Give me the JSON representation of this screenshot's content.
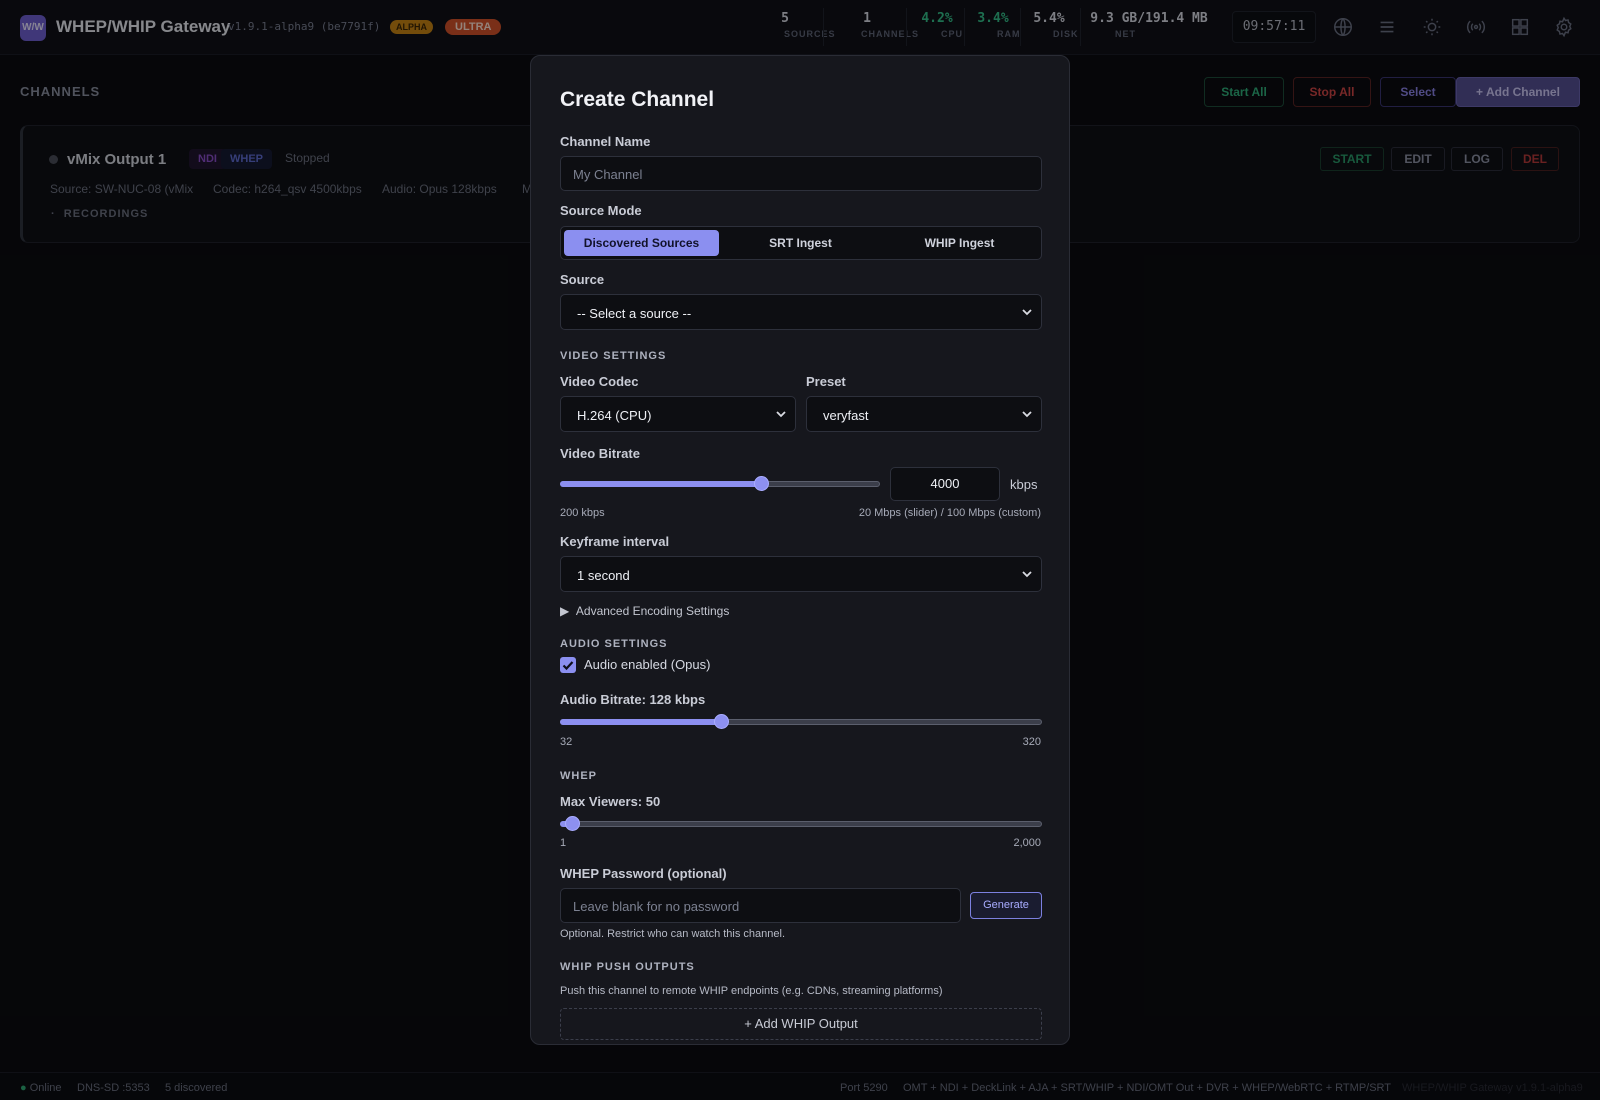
{
  "app": {
    "logo_text": "W/W",
    "title": "WHEP/WHIP Gateway",
    "version": "v1.9.1-alpha9 (be7791f)",
    "badge_alpha": "ALPHA",
    "badge_ultra": "ULTRA",
    "accent_color": "#8b8ff0"
  },
  "stats": [
    {
      "value": "5",
      "label": "SOURCES"
    },
    {
      "value": "1",
      "label": "CHANNELS"
    },
    {
      "value": "4.2%",
      "label": "CPU"
    },
    {
      "value": "3.4%",
      "label": "RAM"
    },
    {
      "value": "5.4%",
      "label": "DISK"
    },
    {
      "value": "9.3 GB/191.4 MB",
      "label": "NET"
    }
  ],
  "clock": "09:57:11",
  "toolbar_icons": [
    "globe-icon",
    "menu-icon",
    "sun-icon",
    "broadcast-icon",
    "grid-icon",
    "gear-icon"
  ],
  "page": {
    "section_title": "CHANNELS",
    "start_all": "Start All",
    "stop_all": "Stop All",
    "select": "Select",
    "add_channel": "+ Add Channel"
  },
  "channel": {
    "name": "vMix Output 1",
    "tags": [
      "NDI",
      "WHEP"
    ],
    "status": "Stopped",
    "source": "Source: SW-NUC-08 (vMix",
    "codec": "Codec: h264_qsv 4500kbps",
    "audio": "Audio: Opus 128kbps",
    "more": "M",
    "recordings": "RECORDINGS",
    "actions": [
      "START",
      "EDIT",
      "LOG",
      "DEL"
    ]
  },
  "modal": {
    "title": "Create Channel",
    "channel_name_label": "Channel Name",
    "channel_name_placeholder": "My Channel",
    "source_mode_label": "Source Mode",
    "source_modes": [
      "Discovered Sources",
      "SRT Ingest",
      "WHIP Ingest"
    ],
    "source_mode_active": "Discovered Sources",
    "source_label": "Source",
    "source_value": "-- Select a source --",
    "video_section": "VIDEO SETTINGS",
    "video_codec_label": "Video Codec",
    "video_codec_value": "H.264 (CPU)",
    "preset_label": "Preset",
    "preset_value": "veryfast",
    "video_bitrate_label": "Video Bitrate",
    "video_bitrate_value": "4000",
    "video_bitrate_unit": "kbps",
    "video_bitrate_slider_fraction": 0.627,
    "video_bitrate_min": "200 kbps",
    "video_bitrate_max": "20 Mbps (slider) / 100 Mbps (custom)",
    "keyframe_label": "Keyframe interval",
    "keyframe_value": "1 second",
    "advanced_label": "Advanced Encoding Settings",
    "audio_section": "AUDIO SETTINGS",
    "audio_enabled_label": "Audio enabled (Opus)",
    "audio_enabled": true,
    "audio_bitrate_label": "Audio Bitrate: 128 kbps",
    "audio_bitrate_fraction": 0.333,
    "audio_min": "32",
    "audio_max": "320",
    "whep_section": "WHEP",
    "max_viewers_label": "Max Viewers: 50",
    "max_viewers_fraction": 0.0245,
    "viewers_min": "1",
    "viewers_max": "2,000",
    "whep_password_label": "WHEP Password (optional)",
    "whep_password_placeholder": "Leave blank for no password",
    "generate_label": "Generate",
    "whep_password_help": "Optional. Restrict who can watch this channel.",
    "whip_section": "WHIP PUSH OUTPUTS",
    "whip_help": "Push this channel to remote WHIP endpoints (e.g. CDNs, streaming platforms)",
    "add_whip_label": "+ Add WHIP Output"
  },
  "footer": {
    "online": "Online",
    "dns": "DNS-SD :5353",
    "discovered": "5 discovered",
    "port": "Port 5290",
    "features": "OMT + NDI + DeckLink + AJA + SRT/WHIP + NDI/OMT Out + DVR + WHEP/WebRTC + RTMP/SRT",
    "footer_brand": "WHEP/WHIP Gateway v1.9.1-alpha9"
  }
}
